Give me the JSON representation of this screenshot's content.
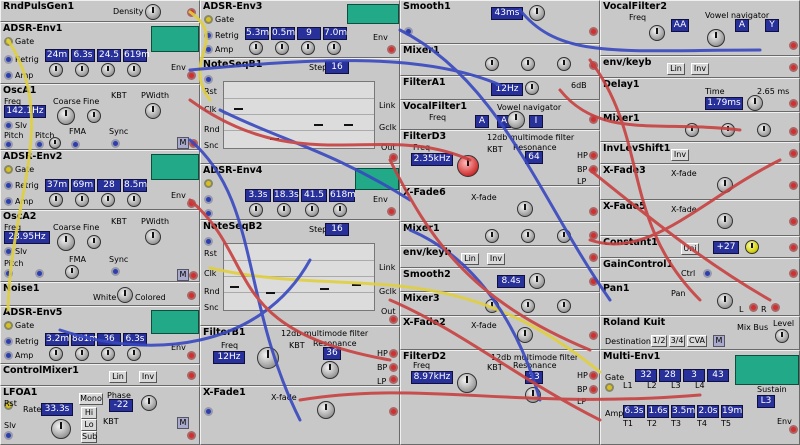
{
  "modules": {
    "rndpuls": {
      "title": "RndPulsGen1",
      "density_label": "Density"
    },
    "adsr1": {
      "title": "ADSR-Env1",
      "gate": "Gate",
      "retrig": "Retrig",
      "amp": "Amp",
      "env": "Env",
      "values": [
        "24m",
        "6.3s",
        "24.5",
        "619m"
      ]
    },
    "osc1": {
      "title": "OscA1",
      "freq_label": "Freq",
      "freq": "142.1Hz",
      "coarse": "Coarse",
      "fine": "Fine",
      "kbt": "KBT",
      "pwidth": "PWidth",
      "slv": "Slv",
      "pitch": "Pitch",
      "fma": "FMA",
      "sync": "Sync",
      "m": "M"
    },
    "adsr2": {
      "title": "ADSR-Env2",
      "gate": "Gate",
      "retrig": "Retrig",
      "amp": "Amp",
      "env": "Env",
      "values": [
        "37m",
        "69m",
        "28",
        "8.5m"
      ]
    },
    "osc2": {
      "title": "OscA2",
      "freq_label": "Freq",
      "freq": "23.95Hz",
      "coarse": "Coarse",
      "fine": "Fine",
      "kbt": "KBT",
      "pwidth": "PWidth",
      "slv": "Slv",
      "pitch": "Pitch",
      "fma": "FMA",
      "sync": "Sync",
      "m": "M"
    },
    "noise1": {
      "title": "Noise1",
      "white": "White",
      "colored": "Colored"
    },
    "adsr5": {
      "title": "ADSR-Env5",
      "gate": "Gate",
      "retrig": "Retrig",
      "amp": "Amp",
      "env": "Env",
      "values": [
        "3.2m",
        "881m",
        "36",
        "6.3s"
      ]
    },
    "ctrlmix": {
      "title": "ControlMixer1",
      "lin": "Lin",
      "inv": "Inv"
    },
    "lfoa": {
      "title": "LFOA1",
      "rst": "Rst",
      "slv": "Slv",
      "rate_label": "Rate",
      "rate": "33.3s",
      "phase_label": "Phase",
      "phase": "-22",
      "mono": "Mono",
      "hi": "Hi",
      "lo": "Lo",
      "sub": "Sub",
      "kbt": "KBT",
      "m": "M"
    },
    "adsr3": {
      "title": "ADSR-Env3",
      "gate": "Gate",
      "retrig": "Retrig",
      "amp": "Amp",
      "env": "Env",
      "values": [
        "5.3m",
        "0.5m",
        "9",
        "7.0m"
      ]
    },
    "noteseq1": {
      "title": "NoteSeqB1",
      "step_label": "Step",
      "step": "16",
      "rst": "Rst",
      "clk": "Clk",
      "rnd": "Rnd",
      "snc": "Snc",
      "link": "Link",
      "gclk": "Gclk",
      "out": "Out",
      "numbers": [
        "1",
        "2",
        "3",
        "4",
        "5",
        "6",
        "7",
        "8",
        "9",
        "10",
        "11",
        "12",
        "13",
        "14",
        "15",
        "16"
      ]
    },
    "adsr4": {
      "title": "ADSR-Env4",
      "values": [
        "3.3s",
        "18.3s",
        "41.5",
        "618m"
      ],
      "env": "Env"
    },
    "noteseq2": {
      "title": "NoteSeqB2",
      "step_label": "Step",
      "step": "16",
      "rst": "Rst",
      "clk": "Clk",
      "rnd": "Rnd",
      "snc": "Snc",
      "link": "Link",
      "gclk": "Gclk",
      "out": "Out",
      "numbers": [
        "1",
        "2",
        "3",
        "4",
        "5",
        "6",
        "7",
        "8",
        "9",
        "10",
        "11",
        "12",
        "13",
        "14",
        "15",
        "16"
      ]
    },
    "filterb1": {
      "title": "FilterB1",
      "subtitle": "12db multimode filter",
      "freq_label": "Freq",
      "freq": "12Hz",
      "kbt": "KBT",
      "res_label": "Resonance",
      "res": "36",
      "hp": "HP",
      "bp": "BP",
      "lp": "LP"
    },
    "xfade1": {
      "title": "X-Fade1",
      "xfade": "X-fade"
    },
    "smooth1": {
      "title": "Smooth1",
      "value": "43ms"
    },
    "mixer1a": {
      "title": "Mixer1"
    },
    "filtera1": {
      "title": "FilterA1",
      "freq": "12Hz",
      "db": "6dB"
    },
    "vocal1": {
      "title": "VocalFilter1",
      "subtitle": "Vowel navigator",
      "freq": "Freq",
      "v1": "A",
      "v2": "A",
      "v3": "I"
    },
    "filterd3": {
      "title": "FilterD3",
      "subtitle": "12db multimode filter",
      "freq_label": "Freq",
      "freq": "2.35kHz",
      "kbt": "KBT",
      "res_label": "Resonance",
      "res": "64",
      "hp": "HP",
      "bp": "BP",
      "lp": "LP"
    },
    "xfade6": {
      "title": "X-Fade6",
      "xfade": "X-fade"
    },
    "mixer1b": {
      "title": "Mixer1"
    },
    "envkeyb1": {
      "title": "env/keyb",
      "lin": "Lin",
      "inv": "Inv"
    },
    "smooth2": {
      "title": "Smooth2",
      "value": "8.4s"
    },
    "mixer3": {
      "title": "Mixer3"
    },
    "xfade2": {
      "title": "X-Fade2",
      "xfade": "X-fade"
    },
    "filterd2": {
      "title": "FilterD2",
      "subtitle": "12db multimode filter",
      "freq_label": "Freq",
      "freq": "8.97kHz",
      "kbt": "KBT",
      "res_label": "Resonance",
      "res": "33",
      "hp": "HP",
      "bp": "BP",
      "lp": "LP"
    },
    "vocal2": {
      "title": "VocalFilter2",
      "subtitle": "Vowel navigator",
      "freq": "Freq",
      "v1": "AA",
      "v2": "A",
      "v3": "Y"
    },
    "envkeyb2": {
      "title": "env/keyb",
      "lin": "Lin",
      "inv": "Inv"
    },
    "delay1": {
      "title": "Delay1",
      "time_label": "Time",
      "time": "1.79ms",
      "max": "2.65 ms"
    },
    "mixer1c": {
      "title": "Mixer1"
    },
    "invlev": {
      "title": "InvLevShift1",
      "inv": "Inv"
    },
    "xfade3": {
      "title": "X-Fade3",
      "xfade": "X-fade"
    },
    "xfade5": {
      "title": "X-Fade5",
      "xfade": "X-fade"
    },
    "constant1": {
      "title": "Constant1",
      "uni": "Uni",
      "value": "+27"
    },
    "gainctrl": {
      "title": "GainControl1",
      "ctrl": "Ctrl"
    },
    "pan1": {
      "title": "Pan1",
      "pan": "Pan",
      "l": "L",
      "r": "R"
    },
    "roland": {
      "title": "Roland Kuit",
      "mixbus": "Mix Bus",
      "level": "Level",
      "dest_label": "Destination",
      "dest_opts": [
        "1/2",
        "3/4",
        "CVA"
      ],
      "m": "M"
    },
    "multienv": {
      "title": "Multi-Env1",
      "gate": "Gate",
      "amp": "Amp",
      "env": "Env",
      "sustain_label": "Sustain",
      "sustain": "L3",
      "levels": [
        "32",
        "28",
        "3",
        "43"
      ],
      "times": [
        "6.3s",
        "1.6s",
        "3.5m",
        "2.0s",
        "19m"
      ],
      "l1": "L1",
      "l2": "L2",
      "l3": "L3",
      "l4": "L4",
      "t1": "T1",
      "t2": "T2",
      "t3": "T3",
      "t4": "T4",
      "t5": "T5"
    }
  },
  "colors": {
    "cable_red": "#c84040",
    "cable_blue": "#3848c0",
    "cable_yellow": "#e0d040",
    "display": "#28309a",
    "module": "#c8c8c8"
  }
}
